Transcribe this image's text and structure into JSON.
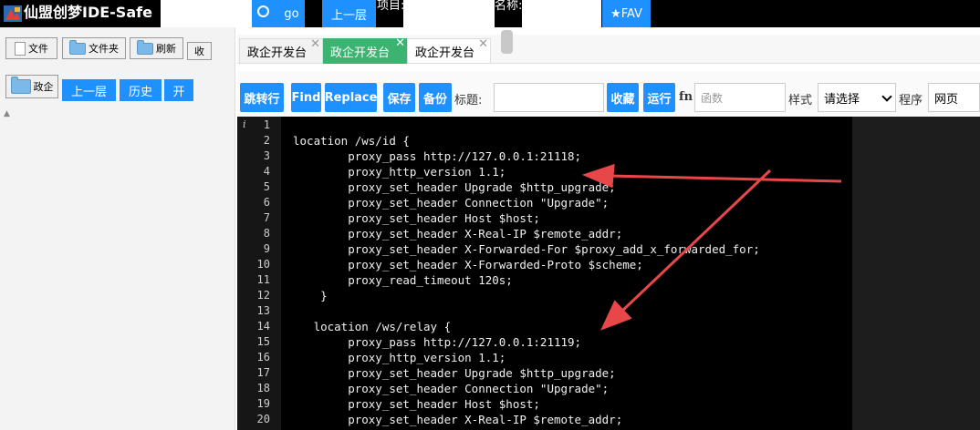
{
  "topbar": {
    "title": "仙盟创梦IDE-Safe",
    "search_value": "",
    "go_label": "go",
    "up_label": "上一层",
    "project_label": "项目:",
    "project_value": "",
    "name_label": "名称:",
    "name_value": "",
    "fav_label": "★FAV"
  },
  "left_panel": {
    "file_btn": "文件",
    "folder_btn": "文件夹",
    "refresh_btn": "刷新",
    "collapse_btn": "收",
    "current_folder": "政企",
    "up_btn": "上一层",
    "history_btn": "历史",
    "open_btn": "开",
    "tree_marker": "▲"
  },
  "tabs": [
    {
      "label": "政企开发台",
      "active": false,
      "close": "✕"
    },
    {
      "label": "政企开发台",
      "active": true,
      "close": "✕"
    },
    {
      "label": "政企开发台",
      "active": false,
      "close": "✕"
    }
  ],
  "toolbar": {
    "goto_line": "跳转行",
    "find": "Find",
    "replace": "Replace",
    "save": "保存",
    "backup": "备份",
    "title_label": "标题:",
    "title_value": "",
    "favorite": "收藏",
    "run": "运行",
    "fn_label": "fn",
    "func_placeholder": "函数",
    "style_label": "样式",
    "style_value": "请选择",
    "program_label": "程序",
    "program_value": "网页"
  },
  "editor": {
    "info_marker": "i",
    "lines": [
      {
        "n": "1",
        "text": ""
      },
      {
        "n": "2",
        "text": "location /ws/id {"
      },
      {
        "n": "3",
        "text": "        proxy_pass http://127.0.0.1:21118;"
      },
      {
        "n": "4",
        "text": "        proxy_http_version 1.1;"
      },
      {
        "n": "5",
        "text": "        proxy_set_header Upgrade $http_upgrade;"
      },
      {
        "n": "6",
        "text": "        proxy_set_header Connection \"Upgrade\";"
      },
      {
        "n": "7",
        "text": "        proxy_set_header Host $host;"
      },
      {
        "n": "8",
        "text": "        proxy_set_header X-Real-IP $remote_addr;"
      },
      {
        "n": "9",
        "text": "        proxy_set_header X-Forwarded-For $proxy_add_x_forwarded_for;"
      },
      {
        "n": "10",
        "text": "        proxy_set_header X-Forwarded-Proto $scheme;"
      },
      {
        "n": "11",
        "text": "        proxy_read_timeout 120s;"
      },
      {
        "n": "12",
        "text": "    }"
      },
      {
        "n": "13",
        "text": ""
      },
      {
        "n": "14",
        "text": "   location /ws/relay {"
      },
      {
        "n": "15",
        "text": "        proxy_pass http://127.0.0.1:21119;"
      },
      {
        "n": "16",
        "text": "        proxy_http_version 1.1;"
      },
      {
        "n": "17",
        "text": "        proxy_set_header Upgrade $http_upgrade;"
      },
      {
        "n": "18",
        "text": "        proxy_set_header Connection \"Upgrade\";"
      },
      {
        "n": "19",
        "text": "        proxy_set_header Host $host;"
      },
      {
        "n": "20",
        "text": "        proxy_set_header X-Real-IP $remote_addr;"
      }
    ]
  },
  "colors": {
    "accent_blue": "#1e90ff",
    "editor_bg": "#000000",
    "annotation_red": "#e8474a",
    "active_tab": "#3cb371"
  }
}
